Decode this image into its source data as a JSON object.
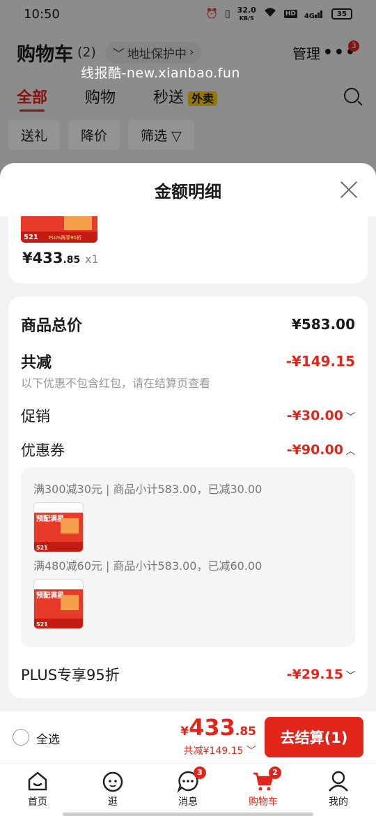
{
  "status_bar": {
    "time": "10:50",
    "net_speed": "32.0",
    "net_unit": "KB/S",
    "hd": "HD",
    "signal": "4G",
    "battery": "35"
  },
  "cart_header": {
    "title": "购物车",
    "count": "(2)",
    "address": "地址保护中",
    "manage": "管理",
    "more_badge": "3"
  },
  "watermark": "线报酷-new.xianbao.fun",
  "tabs": [
    {
      "label": "全部"
    },
    {
      "label": "购物"
    },
    {
      "label": "秒送"
    }
  ],
  "waimai_tag": "外卖",
  "chips": [
    "送礼",
    "降价",
    "筛选"
  ],
  "sheet": {
    "title": "金额明细",
    "product": {
      "price_int": "¥433",
      "price_dec": ".85",
      "qty": "x1",
      "thumb_tag": "521",
      "thumb_text": "PLUS再享95折"
    },
    "rows": {
      "total_label": "商品总价",
      "total_value": "¥583.00",
      "discount_label": "共减",
      "discount_value": "-¥149.15",
      "note": "以下优惠不包含红包，请在结算页查看",
      "promo_label": "促销",
      "promo_value": "-¥30.00",
      "coupon_label": "优惠券",
      "coupon_value": "-¥90.00",
      "plus_label": "PLUS专享95折",
      "plus_value": "-¥29.15"
    },
    "coupons": [
      {
        "text": "满300减30元 | 商品小计583.00，已减30.00",
        "thumb_title": "预配满星",
        "thumb_tag": "521"
      },
      {
        "text": "满480减60元 | 商品小计583.00，已减60.00",
        "thumb_title": "预配满星",
        "thumb_tag": "521"
      }
    ]
  },
  "checkout": {
    "select_all": "全选",
    "yen": "¥",
    "total_int": "433",
    "total_dec": ".85",
    "saved": "共减¥149.15",
    "button": "去结算(1)"
  },
  "tabbar": [
    {
      "label": "首页",
      "icon": "home-icon"
    },
    {
      "label": "逛",
      "icon": "browse-icon"
    },
    {
      "label": "消息",
      "icon": "message-icon",
      "badge": "3"
    },
    {
      "label": "购物车",
      "icon": "cart-icon",
      "badge": "2"
    },
    {
      "label": "我的",
      "icon": "profile-icon"
    }
  ],
  "colors": {
    "accent": "#e1251b",
    "waimai": "#ffcc00"
  }
}
